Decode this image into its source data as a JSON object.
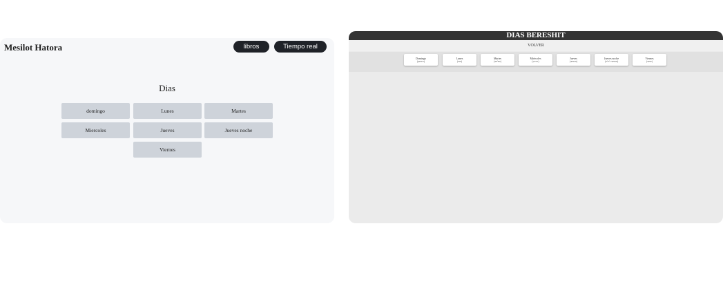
{
  "left": {
    "brand": "Mesilot Hatora",
    "nav": {
      "libros": "libros",
      "tiempo_real": "Tiempo real"
    },
    "title": "Dias",
    "days": [
      "domingo",
      "Lunes",
      "Martes",
      "Miercoles",
      "Jueves",
      "Jueves noche",
      "Viernes"
    ]
  },
  "right": {
    "header": "DIAS BERESHIT",
    "volver": "VOLVER",
    "cards": [
      {
        "name": "Domingo",
        "hebrew": "(ראשון)"
      },
      {
        "name": "Lunes",
        "hebrew": "(שני)"
      },
      {
        "name": "Martes",
        "hebrew": "(שלישי)"
      },
      {
        "name": "Miércoles",
        "hebrew": "(רביעי)"
      },
      {
        "name": "Jueves",
        "hebrew": "(חמישי)"
      },
      {
        "name": "Jueves noche",
        "hebrew": "(חמישי לילה)"
      },
      {
        "name": "Viernes",
        "hebrew": "(שישי)"
      }
    ]
  }
}
